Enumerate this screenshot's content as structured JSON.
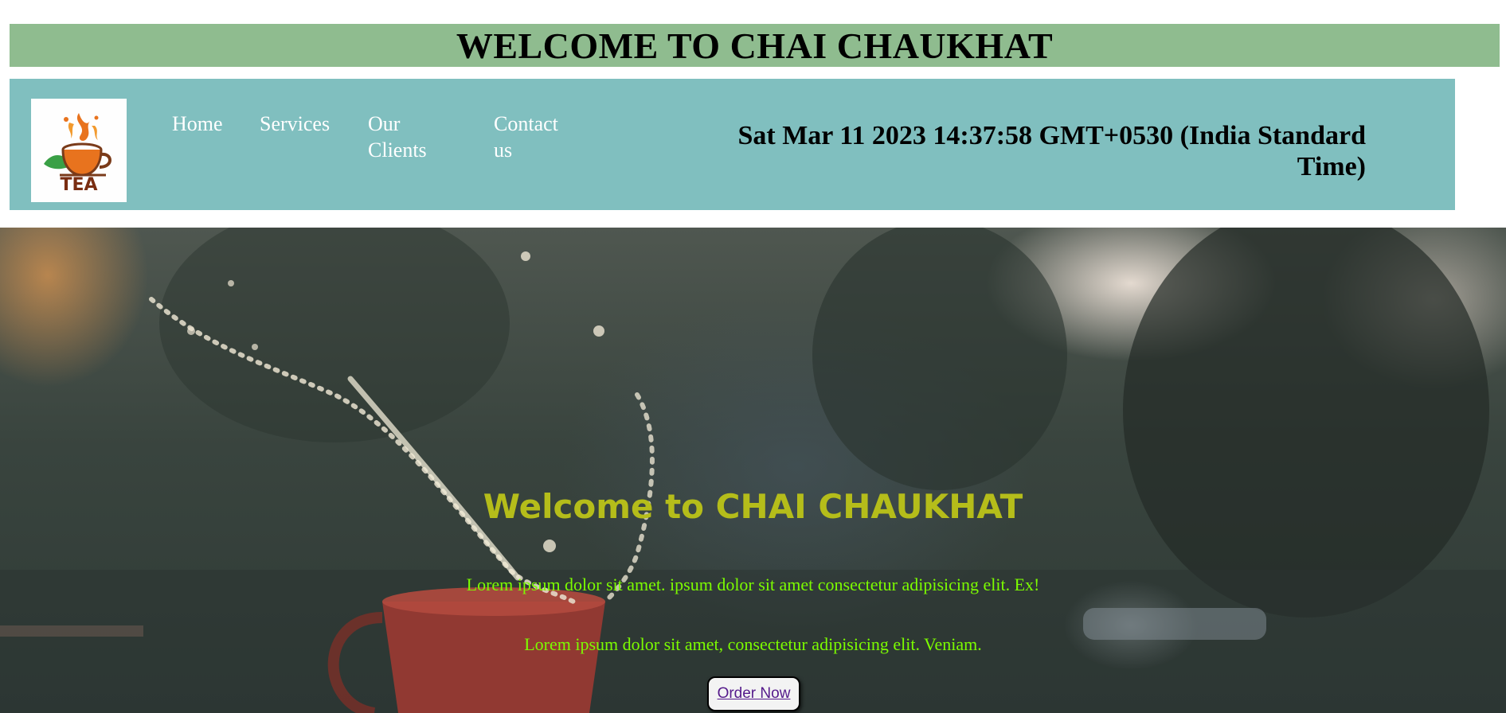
{
  "header": {
    "banner_title": "WELCOME TO CHAI CHAUKHAT"
  },
  "navbar": {
    "logo_text": "TEA",
    "logo_icon": "tea-cup-logo",
    "links": [
      {
        "label": "Home"
      },
      {
        "label": "Services"
      },
      {
        "label": "Our Clients"
      },
      {
        "label": "Contact us"
      }
    ],
    "datetime": "Sat Mar 11 2023 14:37:58 GMT+0530 (India Standard Time)"
  },
  "hero": {
    "title": "Welcome to CHAI CHAUKHAT",
    "line1": "Lorem ipsum dolor sit amet. ipsum dolor sit amet consectetur adipisicing elit. Ex!",
    "line2": "Lorem ipsum dolor sit amet, consectetur adipisicing elit. Veniam.",
    "button_label": "Order Now"
  },
  "colors": {
    "banner_bg": "#8fbc8f",
    "navbar_bg": "#80bfbf",
    "hero_title": "#b5bd1a",
    "hero_text": "#7cfc00",
    "link_visited": "#551a8b"
  }
}
